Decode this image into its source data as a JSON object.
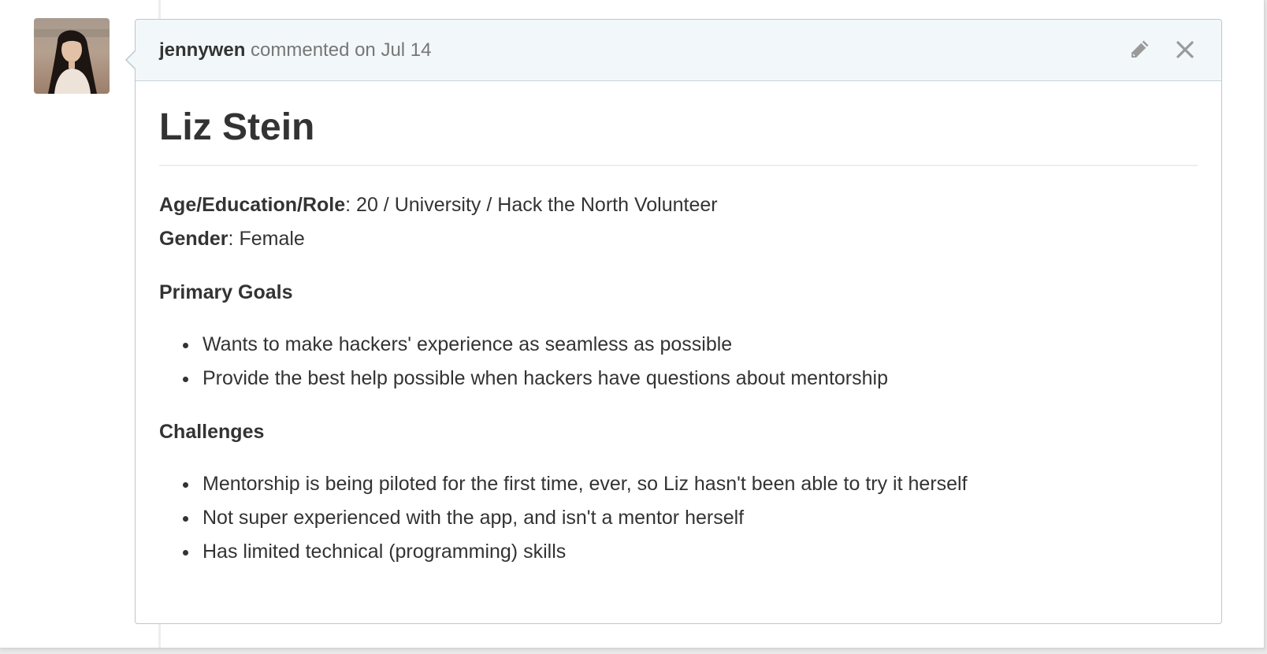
{
  "comment": {
    "author": "jennywen",
    "action_text": " commented on ",
    "timestamp": "Jul 14",
    "actions": {
      "edit_icon": "pencil-icon",
      "close_icon": "close-icon"
    },
    "title": "Liz Stein",
    "fields": [
      {
        "label": "Age/Education/Role",
        "separator": ": ",
        "value": "20 / University / Hack the North Volunteer"
      },
      {
        "label": "Gender",
        "separator": ": ",
        "value": "Female"
      }
    ],
    "sections": [
      {
        "heading": "Primary Goals",
        "items": [
          "Wants to make hackers' experience as seamless as possible",
          "Provide the best help possible when hackers have questions about mentorship"
        ]
      },
      {
        "heading": "Challenges",
        "items": [
          "Mentorship is being piloted for the first time, ever, so Liz hasn't been able to try it herself",
          "Not super experienced with the app, and isn't a mentor herself",
          "Has limited technical (programming) skills"
        ]
      }
    ]
  },
  "colors": {
    "header_bg": "#f2f8fa",
    "border": "#bac6d0",
    "text": "#333333",
    "meta_text": "#767676",
    "icon": "#9a9a9a"
  }
}
